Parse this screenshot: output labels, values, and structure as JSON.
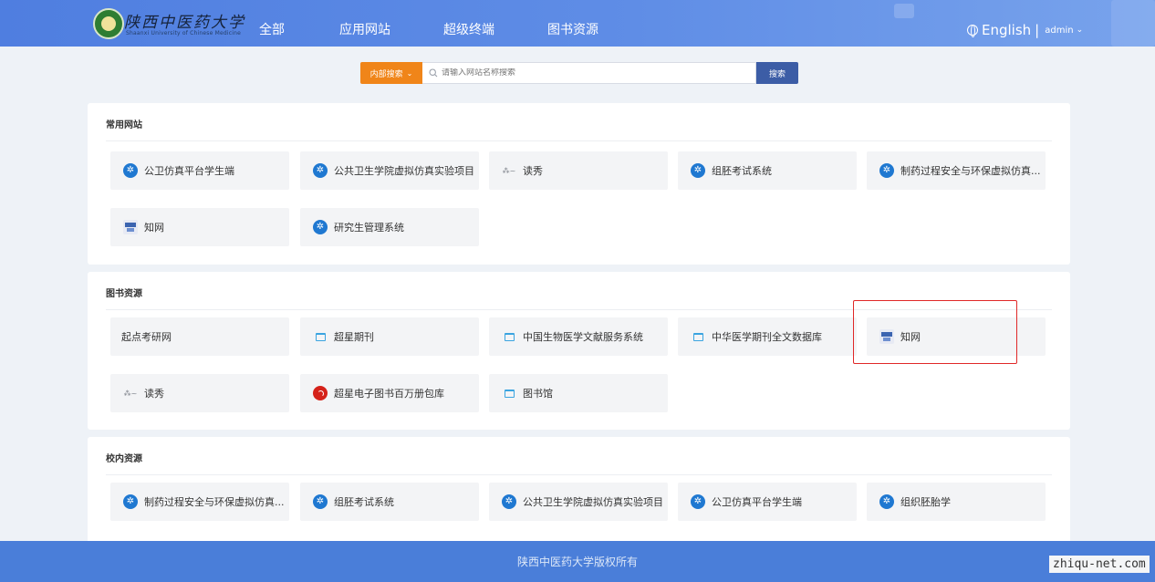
{
  "header": {
    "logo_text": "陕西中医药大学",
    "logo_subtext": "Shaanxi University of Chinese Medicine",
    "nav": [
      "全部",
      "应用网站",
      "超级终端",
      "图书资源"
    ],
    "language": "English",
    "separator": "|",
    "user": "admin"
  },
  "search": {
    "scope_label": "内部搜索",
    "placeholder": "请输入网站名称搜索",
    "button_label": "搜索"
  },
  "sections": [
    {
      "title": "常用网站",
      "items": [
        {
          "label": "公卫仿真平台学生端",
          "icon": "blue-flower-icon"
        },
        {
          "label": "公共卫生学院虚拟仿真实验项目",
          "icon": "blue-flower-icon"
        },
        {
          "label": "读秀",
          "icon": "duxiu-icon"
        },
        {
          "label": "组胚考试系统",
          "icon": "blue-flower-icon"
        },
        {
          "label": "制药过程安全与环保虚拟仿真...",
          "icon": "blue-flower-icon"
        },
        {
          "label": "知网",
          "icon": "cnki-icon"
        },
        {
          "label": "研究生管理系统",
          "icon": "blue-flower-icon"
        }
      ]
    },
    {
      "title": "图书资源",
      "items": [
        {
          "label": "起点考研网",
          "icon": ""
        },
        {
          "label": "超星期刊",
          "icon": "book-box-icon"
        },
        {
          "label": "中国生物医学文献服务系统",
          "icon": "book-box-icon"
        },
        {
          "label": "中华医学期刊全文数据库",
          "icon": "book-box-icon"
        },
        {
          "label": "知网",
          "icon": "cnki-icon"
        },
        {
          "label": "读秀",
          "icon": "duxiu-icon"
        },
        {
          "label": "超星电子图书百万册包库",
          "icon": "red-chaoxing-icon"
        },
        {
          "label": "图书馆",
          "icon": "book-box-icon"
        }
      ]
    },
    {
      "title": "校内资源",
      "items": [
        {
          "label": "制药过程安全与环保虚拟仿真...",
          "icon": "blue-flower-icon"
        },
        {
          "label": "组胚考试系统",
          "icon": "blue-flower-icon"
        },
        {
          "label": "公共卫生学院虚拟仿真实验项目",
          "icon": "blue-flower-icon"
        },
        {
          "label": "公卫仿真平台学生端",
          "icon": "blue-flower-icon"
        },
        {
          "label": "组织胚胎学",
          "icon": "blue-flower-icon"
        }
      ]
    }
  ],
  "footer": {
    "copyright": "陕西中医药大学版权所有"
  },
  "watermark": "zhiqu-net.com",
  "colors": {
    "header": "#5585e3",
    "search_scope": "#f08519",
    "search_button": "#3c5da6",
    "highlight": "#e02828",
    "footer": "#4a7ed9"
  }
}
